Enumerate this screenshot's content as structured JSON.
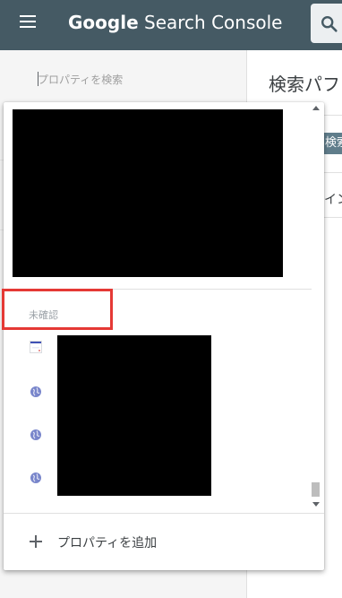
{
  "header": {
    "title_google": "Google",
    "title_product": "Search Console",
    "menu_icon": "hamburger-menu-icon",
    "search_icon": "search-icon",
    "background": "#455a64"
  },
  "sidebar": {
    "property_search_placeholder": "プロパティを検索"
  },
  "main": {
    "page_title": "検索パフ",
    "chip_label": "検索タ",
    "tab_label": "イン"
  },
  "dropdown": {
    "unverified_section_label": "未確認",
    "add_property_label": "プロパティを追加",
    "highlight_color": "#e53935",
    "site_icons": [
      "site-favicon-icon",
      "globe-icon",
      "globe-icon",
      "globe-icon"
    ]
  }
}
